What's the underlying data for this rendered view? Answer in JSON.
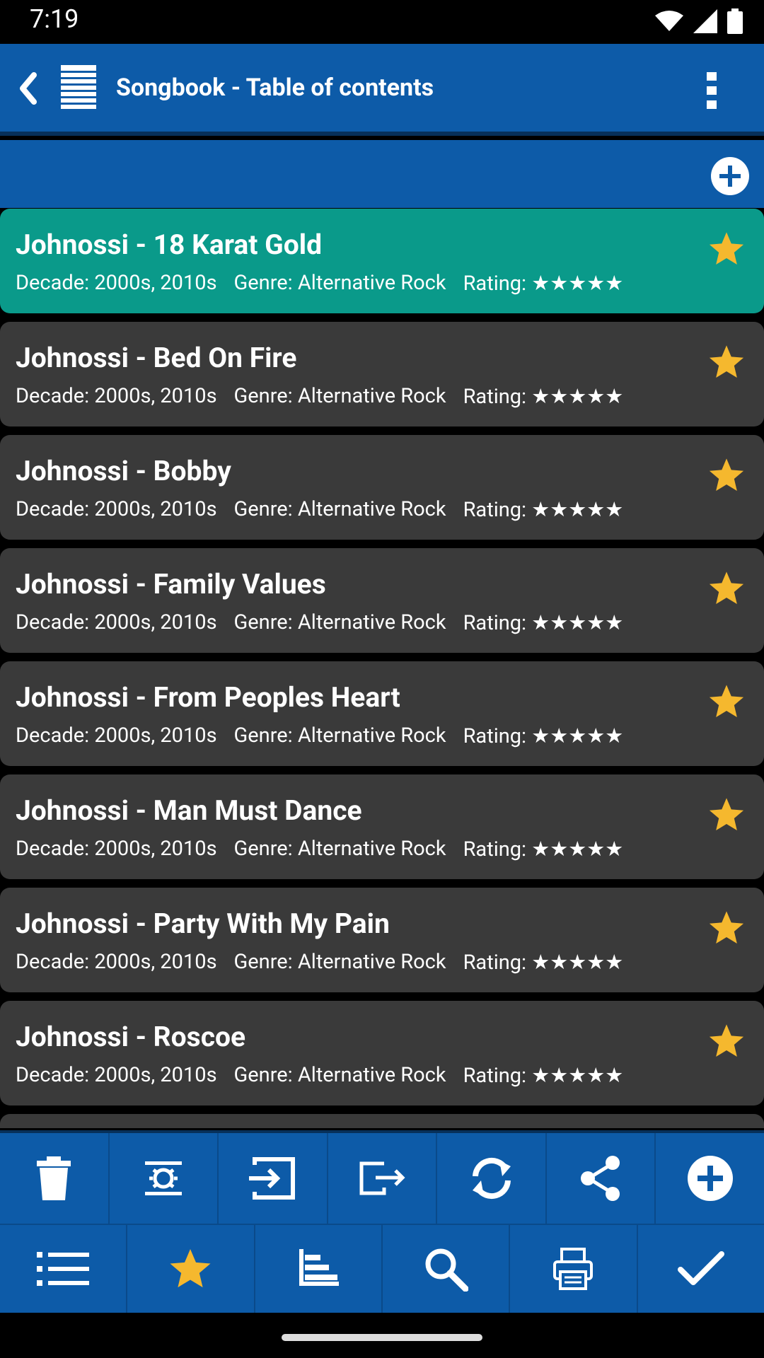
{
  "status": {
    "time": "7:19"
  },
  "app_bar": {
    "title": "Songbook - Table of contents"
  },
  "songs": [
    {
      "title": "Johnossi - 18 Karat Gold",
      "decade": "Decade: 2000s, 2010s",
      "genre": "Genre: Alternative Rock",
      "rating": "Rating: ★★★★★",
      "selected": true
    },
    {
      "title": "Johnossi - Bed On Fire",
      "decade": "Decade: 2000s, 2010s",
      "genre": "Genre: Alternative Rock",
      "rating": "Rating: ★★★★★"
    },
    {
      "title": "Johnossi - Bobby",
      "decade": "Decade: 2000s, 2010s",
      "genre": "Genre: Alternative Rock",
      "rating": "Rating: ★★★★★"
    },
    {
      "title": "Johnossi - Family Values",
      "decade": "Decade: 2000s, 2010s",
      "genre": "Genre: Alternative Rock",
      "rating": "Rating: ★★★★★"
    },
    {
      "title": "Johnossi - From Peoples Heart",
      "decade": "Decade: 2000s, 2010s",
      "genre": "Genre: Alternative Rock",
      "rating": "Rating: ★★★★★"
    },
    {
      "title": "Johnossi - Man Must Dance",
      "decade": "Decade: 2000s, 2010s",
      "genre": "Genre: Alternative Rock",
      "rating": "Rating: ★★★★★"
    },
    {
      "title": "Johnossi - Party With My Pain",
      "decade": "Decade: 2000s, 2010s",
      "genre": "Genre: Alternative Rock",
      "rating": "Rating: ★★★★★"
    },
    {
      "title": "Johnossi - Roscoe",
      "decade": "Decade: 2000s, 2010s",
      "genre": "Genre: Alternative Rock",
      "rating": "Rating: ★★★★★"
    }
  ],
  "toolbar_top": [
    {
      "icon": "trash-icon"
    },
    {
      "icon": "brightness-icon"
    },
    {
      "icon": "import-icon"
    },
    {
      "icon": "export-icon"
    },
    {
      "icon": "sync-icon"
    },
    {
      "icon": "share-icon"
    },
    {
      "icon": "add-circle-icon"
    }
  ],
  "toolbar_bottom": [
    {
      "icon": "list-icon"
    },
    {
      "icon": "star-icon"
    },
    {
      "icon": "sort-icon"
    },
    {
      "icon": "search-icon"
    },
    {
      "icon": "print-icon"
    },
    {
      "icon": "check-icon"
    }
  ],
  "colors": {
    "primary": "#0d5ba8",
    "selected": "#0a9a8a",
    "item_bg": "#3a3a3a",
    "star": "#f5b82e"
  }
}
